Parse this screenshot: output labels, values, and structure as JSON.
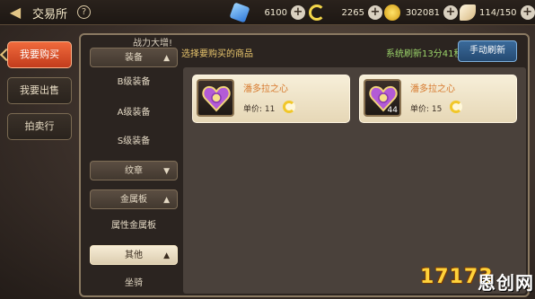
{
  "header": {
    "back_icon": "back-arrow-icon",
    "title": "交易所",
    "help": "?"
  },
  "resources": [
    {
      "name": "diamond",
      "icon": "diamond-icon",
      "value": "6100",
      "plus": "+"
    },
    {
      "name": "c-coin",
      "icon": "c-coin-icon",
      "value": "2265",
      "plus": "+"
    },
    {
      "name": "gold",
      "icon": "gold-coin-icon",
      "value": "302081",
      "plus": "+"
    },
    {
      "name": "fatigue",
      "icon": "wing-icon",
      "value": "114/150",
      "plus": "+"
    }
  ],
  "tabs": [
    {
      "label": "我要购买",
      "active": true
    },
    {
      "label": "我要出售",
      "active": false
    },
    {
      "label": "拍卖行",
      "active": false
    }
  ],
  "panel": {
    "notice": "战力大增!",
    "hint": "选择要购买的商品",
    "refresh_time": "系统刷新13分41秒",
    "refresh_button": "手动刷新"
  },
  "categories": [
    {
      "label": "装备",
      "type": "header",
      "chevron": "▲"
    },
    {
      "label": "B级装备",
      "type": "sub"
    },
    {
      "label": "A级装备",
      "type": "sub"
    },
    {
      "label": "S级装备",
      "type": "sub"
    },
    {
      "label": "纹章",
      "type": "header",
      "chevron": "▼"
    },
    {
      "label": "金属板",
      "type": "header",
      "chevron": "▲"
    },
    {
      "label": "属性金属板",
      "type": "sub"
    },
    {
      "label": "其他",
      "type": "header-open",
      "chevron": "▲"
    },
    {
      "label": "坐骑",
      "type": "sub"
    }
  ],
  "items": [
    {
      "name": "潘多拉之心",
      "price_label": "单价: 11",
      "quantity": "",
      "icon": "pandora-heart-icon"
    },
    {
      "name": "潘多拉之心",
      "price_label": "单价: 15",
      "quantity": "44",
      "icon": "pandora-heart-icon"
    }
  ],
  "watermark": {
    "brand": "17173",
    "sub": "恩创网"
  },
  "colors": {
    "active_tab": "#e0532a",
    "hint_text": "#e9c66d",
    "refresh_text": "#9bd46a",
    "item_name": "#d77a2e",
    "refresh_button": "#2f5e8e"
  }
}
